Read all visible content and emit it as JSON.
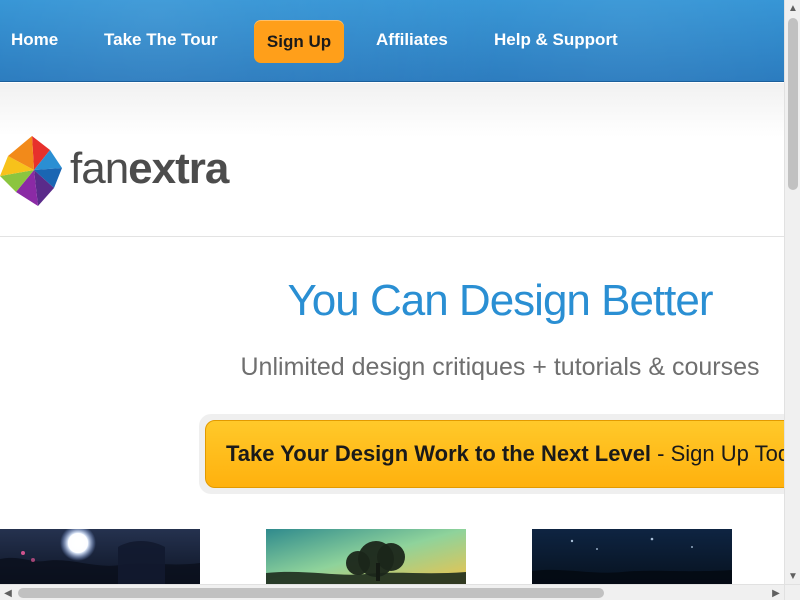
{
  "nav": {
    "items": [
      {
        "label": "Home"
      },
      {
        "label": "Take The Tour"
      },
      {
        "label": "Sign Up"
      },
      {
        "label": "Affiliates"
      },
      {
        "label": "Help & Support"
      }
    ]
  },
  "logo": {
    "text_light": "fan",
    "text_bold": "extra",
    "icon": "pinwheel-logo-icon"
  },
  "hero": {
    "title": "You Can Design Better",
    "subtitle": "Unlimited design critiques + tutorials & courses"
  },
  "cta": {
    "strong": "Take Your Design Work to the Next Level",
    "rest": " - Sign Up Toda"
  },
  "thumbnails": [
    {
      "name": "moonlit-fantasy-thumbnail"
    },
    {
      "name": "tree-at-dusk-thumbnail"
    },
    {
      "name": "night-sky-thumbnail"
    }
  ],
  "scrollbars": {
    "vertical": {
      "up": "▲",
      "down": "▼"
    },
    "horizontal": {
      "left": "◀",
      "right": "▶"
    }
  },
  "colors": {
    "nav_blue": "#2a8fd3",
    "signup_orange": "#ff9f1a",
    "hero_blue": "#2a8fd3",
    "cta_yellow": "#ffc92a"
  }
}
